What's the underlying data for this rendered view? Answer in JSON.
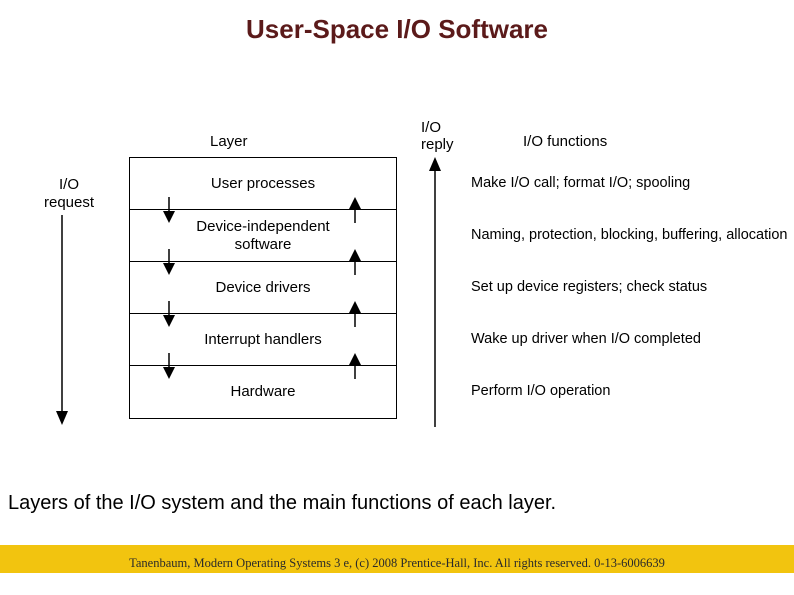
{
  "title": "User-Space I/O Software",
  "headers": {
    "layer": "Layer",
    "reply": "I/O\nreply",
    "functions": "I/O functions",
    "request": "I/O\nrequest"
  },
  "layers": [
    {
      "name": "User processes",
      "function": "Make I/O call; format I/O; spooling"
    },
    {
      "name": "Device-independent\nsoftware",
      "function": "Naming, protection, blocking, buffering, allocation"
    },
    {
      "name": "Device drivers",
      "function": "Set up device registers; check status"
    },
    {
      "name": "Interrupt handlers",
      "function": "Wake up driver when I/O completed"
    },
    {
      "name": "Hardware",
      "function": "Perform I/O operation"
    }
  ],
  "caption": "Layers of the I/O system and the main functions of each layer.",
  "footer": "Tanenbaum, Modern Operating Systems 3 e, (c) 2008 Prentice-Hall, Inc. All rights reserved. 0-13-6006639"
}
